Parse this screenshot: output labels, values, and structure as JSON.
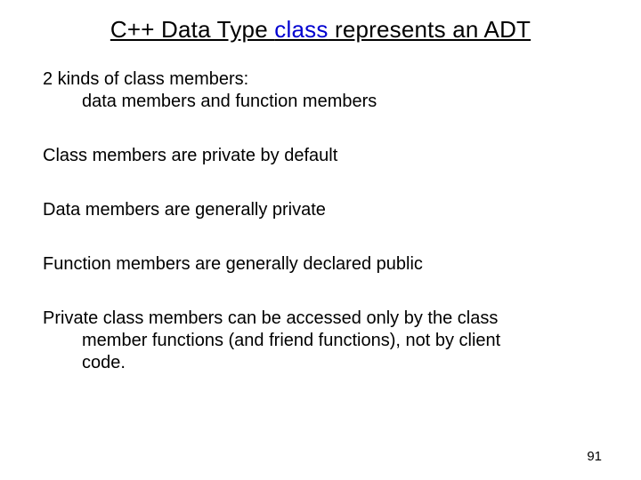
{
  "title_prefix": "C++ Data Type ",
  "title_keyword": "class",
  "title_suffix": " represents an ADT",
  "body": {
    "p1_line1": "2 kinds of class members:",
    "p1_line2": "data members and function members",
    "p2": "Class members are private by default",
    "p3": "Data members are generally private",
    "p4": "Function members are generally declared public",
    "p5_line1": "Private class members can be accessed only by the class",
    "p5_line2": "member functions (and friend functions), not by client",
    "p5_line3": "code."
  },
  "page_number": "91"
}
